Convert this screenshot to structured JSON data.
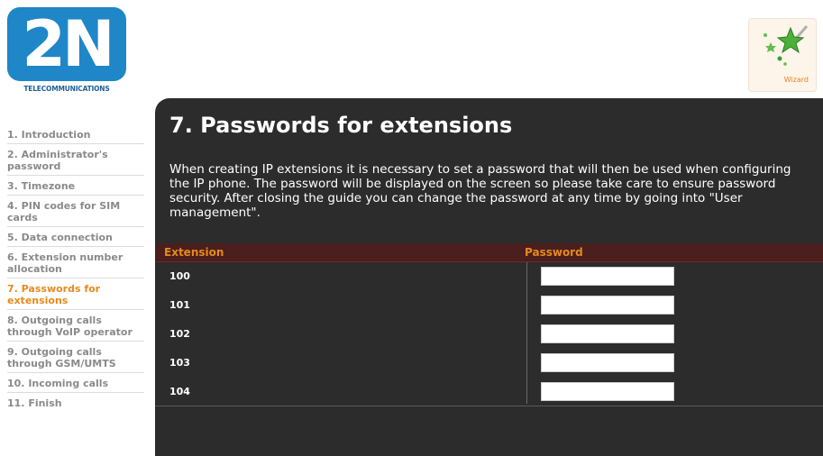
{
  "logo": {
    "text": "2N",
    "subtitle": "TELECOMMUNICATIONS"
  },
  "wizard": {
    "label": "Wizard",
    "icon": "magic-wand-icon"
  },
  "sidebar": {
    "steps": [
      {
        "label": "1. Introduction",
        "active": false
      },
      {
        "label": "2. Administrator's password",
        "active": false
      },
      {
        "label": "3. Timezone",
        "active": false
      },
      {
        "label": "4. PIN codes for SIM cards",
        "active": false
      },
      {
        "label": "5. Data connection",
        "active": false
      },
      {
        "label": "6. Extension number allocation",
        "active": false
      },
      {
        "label": "7. Passwords for extensions",
        "active": true
      },
      {
        "label": "8. Outgoing calls through VoIP operator",
        "active": false
      },
      {
        "label": "9. Outgoing calls through GSM/UMTS",
        "active": false
      },
      {
        "label": "10. Incoming calls",
        "active": false
      },
      {
        "label": "11. Finish",
        "active": false
      }
    ]
  },
  "main": {
    "title": "7. Passwords for extensions",
    "description": "When creating IP extensions it is necessary to set a password that will then be used when configuring the IP phone. The password will be displayed on the screen so please take care to ensure password security. After closing the guide you can change the password at any time by going into \"User management\".",
    "table": {
      "headers": {
        "extension": "Extension",
        "password": "Password"
      },
      "rows": [
        {
          "extension": "100",
          "password": ""
        },
        {
          "extension": "101",
          "password": ""
        },
        {
          "extension": "102",
          "password": ""
        },
        {
          "extension": "103",
          "password": ""
        },
        {
          "extension": "104",
          "password": ""
        }
      ]
    }
  },
  "colors": {
    "accent": "#e68a1c",
    "panel": "#2c2c2c",
    "table_header": "#4a1f1d",
    "logo_blue": "#1f86c8"
  }
}
